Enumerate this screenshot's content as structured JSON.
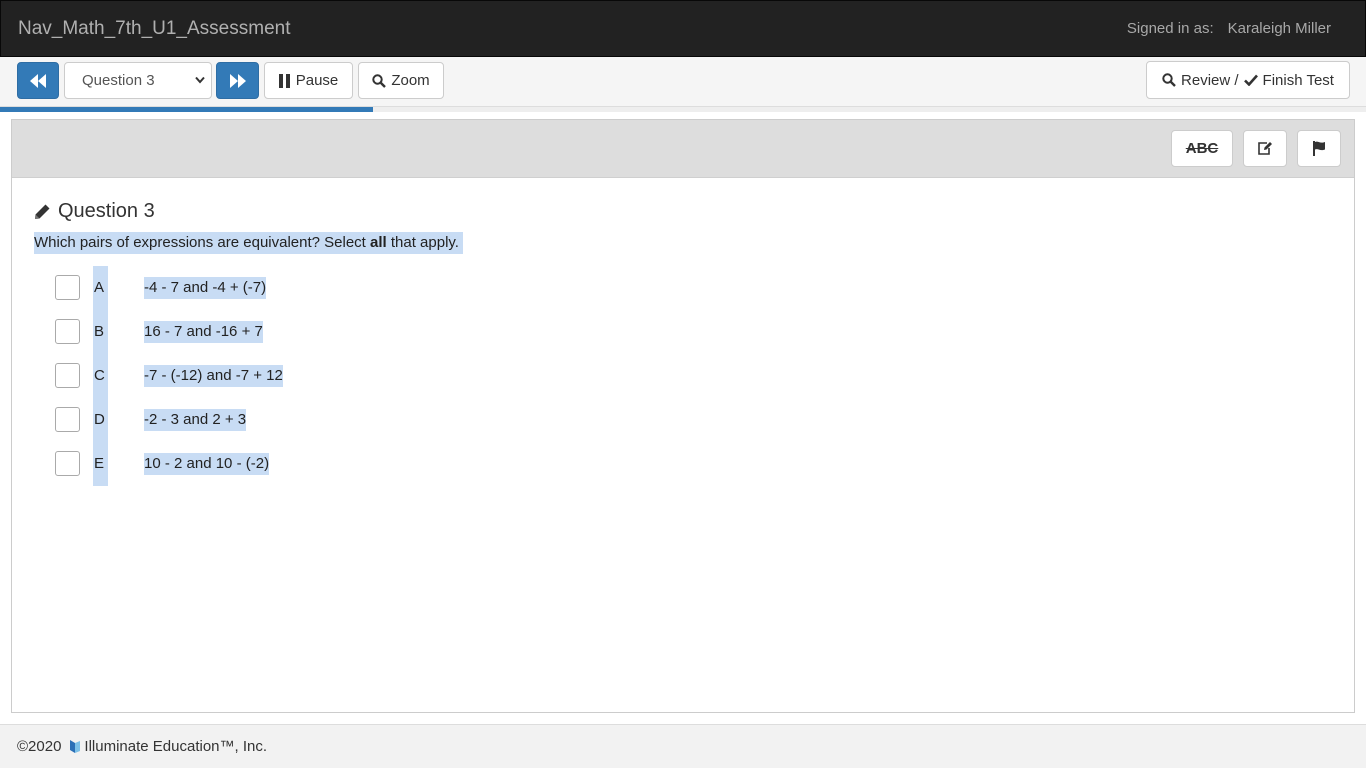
{
  "header": {
    "app_title": "Nav_Math_7th_U1_Assessment",
    "signed_in_label": "Signed in as:",
    "user_name": "Karaleigh Miller"
  },
  "toolbar": {
    "prev_icon": "fast-backward-icon",
    "question_select": {
      "selected": "Question 3"
    },
    "next_icon": "fast-forward-icon",
    "pause_label": "Pause",
    "zoom_label": "Zoom",
    "review_label": "Review /",
    "finish_label": "Finish Test"
  },
  "progress": {
    "fraction": 0.273
  },
  "tools": {
    "strikethrough_label": "ABC",
    "notes_icon": "edit-icon",
    "flag_icon": "flag-icon"
  },
  "question": {
    "title": "Question 3",
    "prompt_pre": "Which pairs of expressions are equivalent? Select ",
    "prompt_bold": "all",
    "prompt_post": " that apply.",
    "choices": [
      {
        "letter": "A",
        "text": "-4 - 7 and -4 + (-7)"
      },
      {
        "letter": "B",
        "text": "16 - 7 and -16 + 7"
      },
      {
        "letter": "C",
        "text": "-7 - (-12) and -7 + 12"
      },
      {
        "letter": "D",
        "text": "-2 - 3 and 2 + 3"
      },
      {
        "letter": "E",
        "text": "10 - 2 and 10 - (-2)"
      }
    ]
  },
  "footer": {
    "copyright": "©2020",
    "company": "Illuminate Education™, Inc."
  },
  "colors": {
    "primary": "#337ab7",
    "highlight": "#c8dcf4",
    "header_bg": "#222222"
  }
}
